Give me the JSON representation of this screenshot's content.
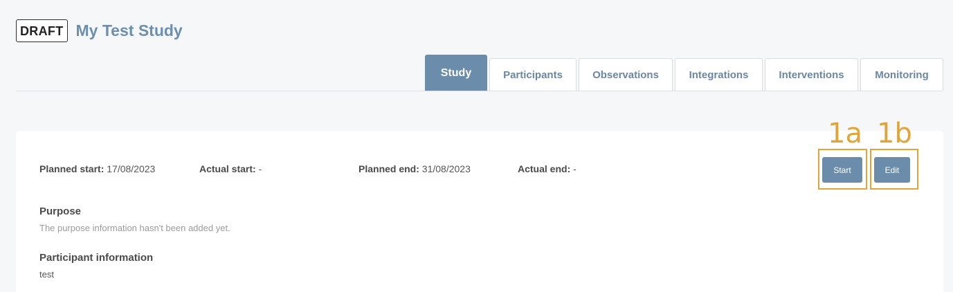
{
  "header": {
    "status_badge": "DRAFT",
    "title": "My Test Study"
  },
  "tabs": [
    {
      "label": "Study",
      "active": true
    },
    {
      "label": "Participants"
    },
    {
      "label": "Observations"
    },
    {
      "label": "Integrations"
    },
    {
      "label": "Interventions"
    },
    {
      "label": "Monitoring"
    }
  ],
  "dates": {
    "planned_start_label": "Planned start:",
    "planned_start_value": "17/08/2023",
    "actual_start_label": "Actual start:",
    "actual_start_value": "-",
    "planned_end_label": "Planned end:",
    "planned_end_value": "31/08/2023",
    "actual_end_label": "Actual end:",
    "actual_end_value": "-"
  },
  "actions": {
    "start_label": "Start",
    "edit_label": "Edit"
  },
  "annotations": {
    "a": "1a",
    "b": "1b",
    "color": "#e0a43a"
  },
  "purpose": {
    "title": "Purpose",
    "text": "The purpose information hasn't been added yet."
  },
  "participant_info": {
    "title": "Participant information",
    "text": "test"
  },
  "colors": {
    "accent": "#6b8cab",
    "title": "#6c8fae",
    "background": "#f6f7f9"
  }
}
